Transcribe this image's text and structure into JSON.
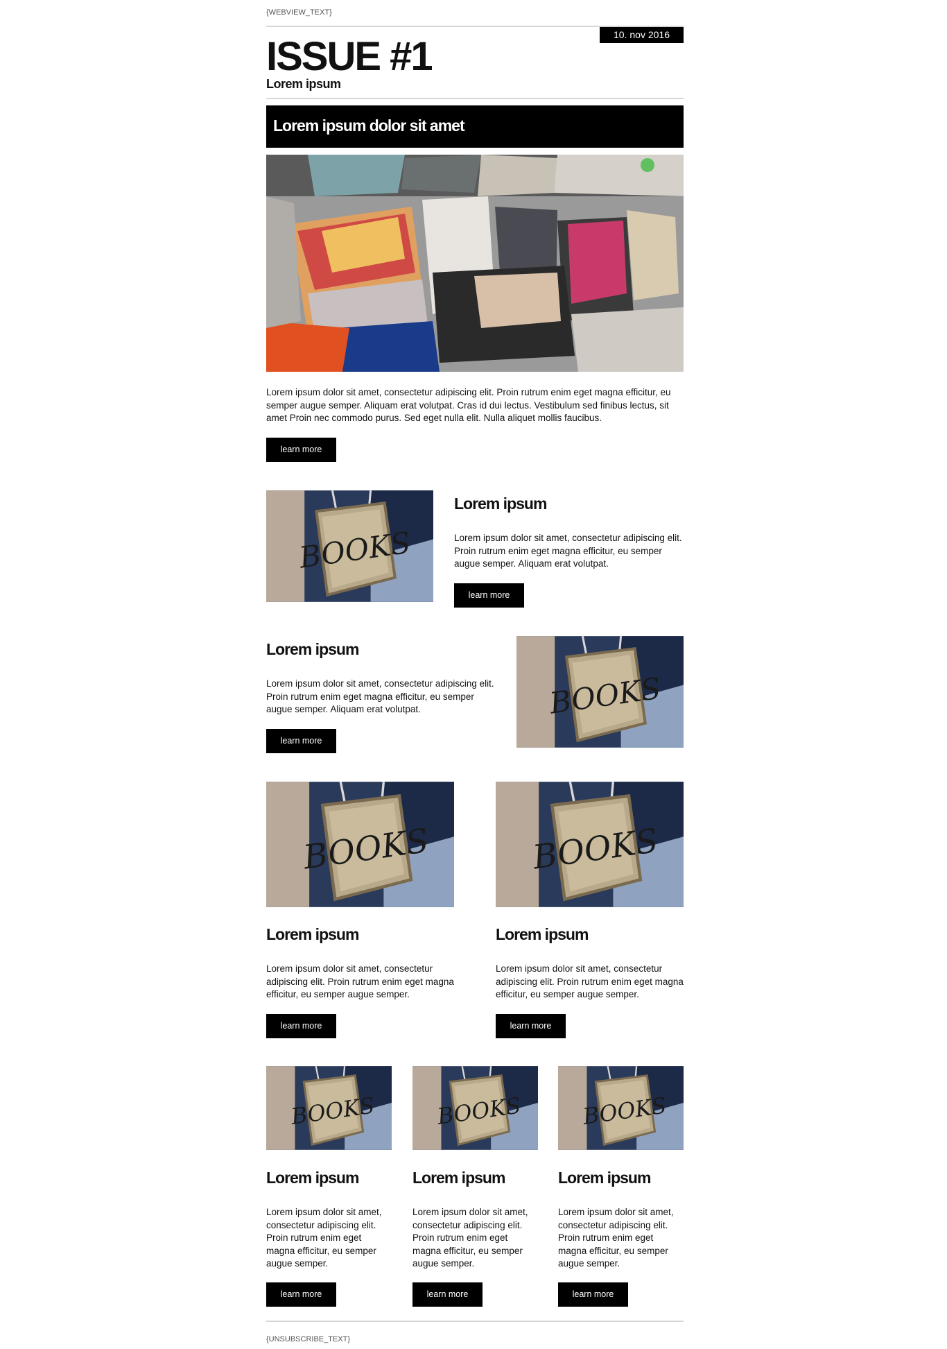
{
  "header": {
    "webview_text": "{WEBVIEW_TEXT}",
    "date": "10. nov 2016",
    "issue_title": "ISSUE #1",
    "subtitle": "Lorem ipsum"
  },
  "hero": {
    "banner_title": "Lorem ipsum dolor sit amet",
    "image_icon": "magazines-photo",
    "text": "Lorem ipsum dolor sit amet, consectetur adipiscing elit. Proin rutrum enim eget magna efficitur, eu semper augue semper. Aliquam erat volutpat. Cras id dui lectus. Vestibulum sed finibus lectus, sit amet Proin nec commodo purus. Sed eget nulla elit. Nulla aliquet mollis faucibus.",
    "button": "learn more"
  },
  "feature_left": {
    "title": "Lorem ipsum",
    "image_icon": "books-sign-photo",
    "text": "Lorem ipsum dolor sit amet, consectetur adipiscing elit. Proin rutrum enim eget magna efficitur, eu semper augue semper. Aliquam erat volutpat.",
    "button": "learn more"
  },
  "feature_right": {
    "title": "Lorem ipsum",
    "image_icon": "books-sign-photo",
    "text": "Lorem ipsum dolor sit amet, consectetur adipiscing elit. Proin rutrum enim eget magna efficitur, eu semper augue semper. Aliquam erat volutpat.",
    "button": "learn more"
  },
  "two_col": [
    {
      "title": "Lorem ipsum",
      "image_icon": "books-sign-photo",
      "text": "Lorem ipsum dolor sit amet, consectetur adipiscing elit. Proin rutrum enim eget magna efficitur, eu semper augue semper.",
      "button": "learn more"
    },
    {
      "title": "Lorem ipsum",
      "image_icon": "books-sign-photo",
      "text": "Lorem ipsum dolor sit amet, consectetur adipiscing elit. Proin rutrum enim eget magna efficitur, eu semper augue semper.",
      "button": "learn more"
    }
  ],
  "three_col": [
    {
      "title": "Lorem ipsum",
      "image_icon": "books-sign-photo",
      "text": "Lorem ipsum dolor sit amet, consectetur adipiscing elit. Proin rutrum enim eget magna efficitur, eu semper augue semper.",
      "button": "learn more"
    },
    {
      "title": "Lorem ipsum",
      "image_icon": "books-sign-photo",
      "text": "Lorem ipsum dolor sit amet, consectetur adipiscing elit. Proin rutrum enim eget magna efficitur, eu semper augue semper.",
      "button": "learn more"
    },
    {
      "title": "Lorem ipsum",
      "image_icon": "books-sign-photo",
      "text": "Lorem ipsum dolor sit amet, consectetur adipiscing elit. Proin rutrum enim eget magna efficitur, eu semper augue semper.",
      "button": "learn more"
    }
  ],
  "footer": {
    "unsubscribe_text": "{UNSUBSCRIBE_TEXT}"
  },
  "colors": {
    "accent": "#000000",
    "rule": "#d6d6d6"
  }
}
